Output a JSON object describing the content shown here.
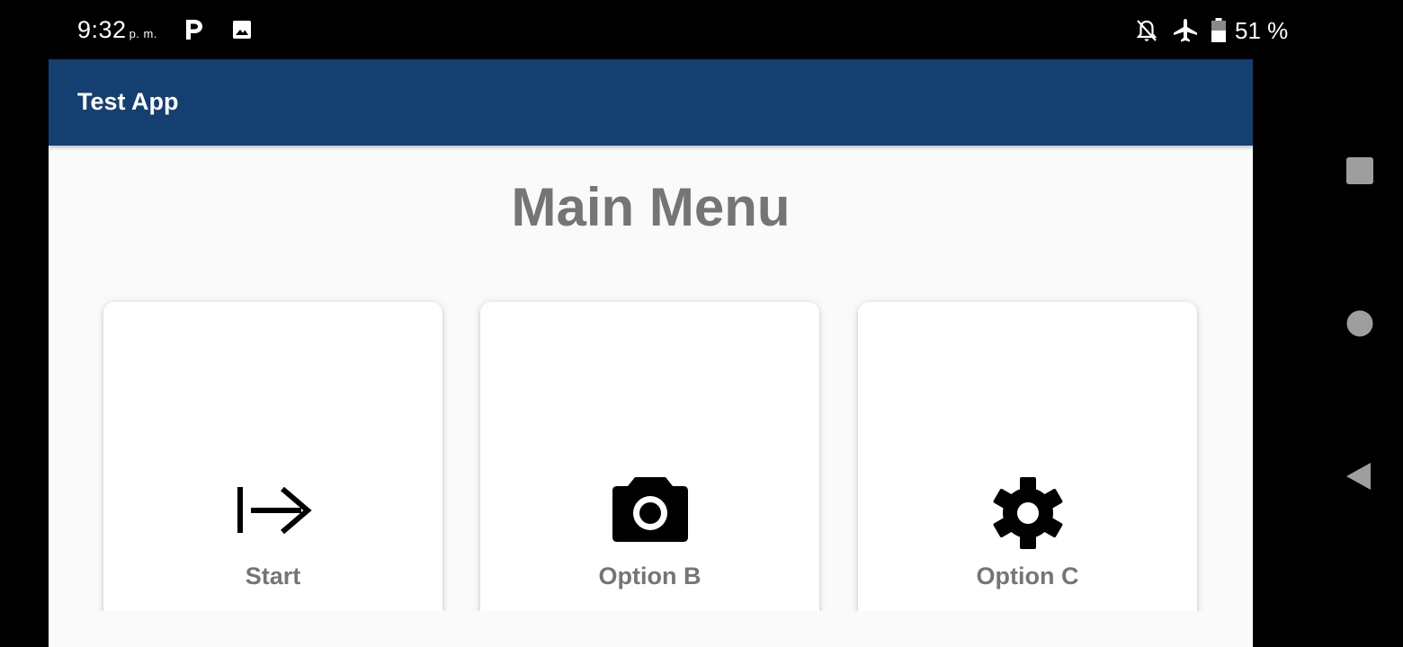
{
  "status_bar": {
    "time": "9:32",
    "ampm": "p. m.",
    "battery": "51 %",
    "icons": [
      "p-app-icon",
      "image-icon",
      "notifications-off-icon",
      "airplane-mode-icon",
      "battery-icon"
    ]
  },
  "app_bar": {
    "title": "Test App",
    "color": "#143f71"
  },
  "main": {
    "title": "Main Menu",
    "cards": [
      {
        "label": "Start",
        "icon": "start-arrow-icon"
      },
      {
        "label": "Option B",
        "icon": "camera-icon"
      },
      {
        "label": "Option C",
        "icon": "settings-gear-icon"
      }
    ]
  },
  "nav": {
    "buttons": [
      "recent-apps-icon",
      "home-icon",
      "back-icon"
    ]
  }
}
